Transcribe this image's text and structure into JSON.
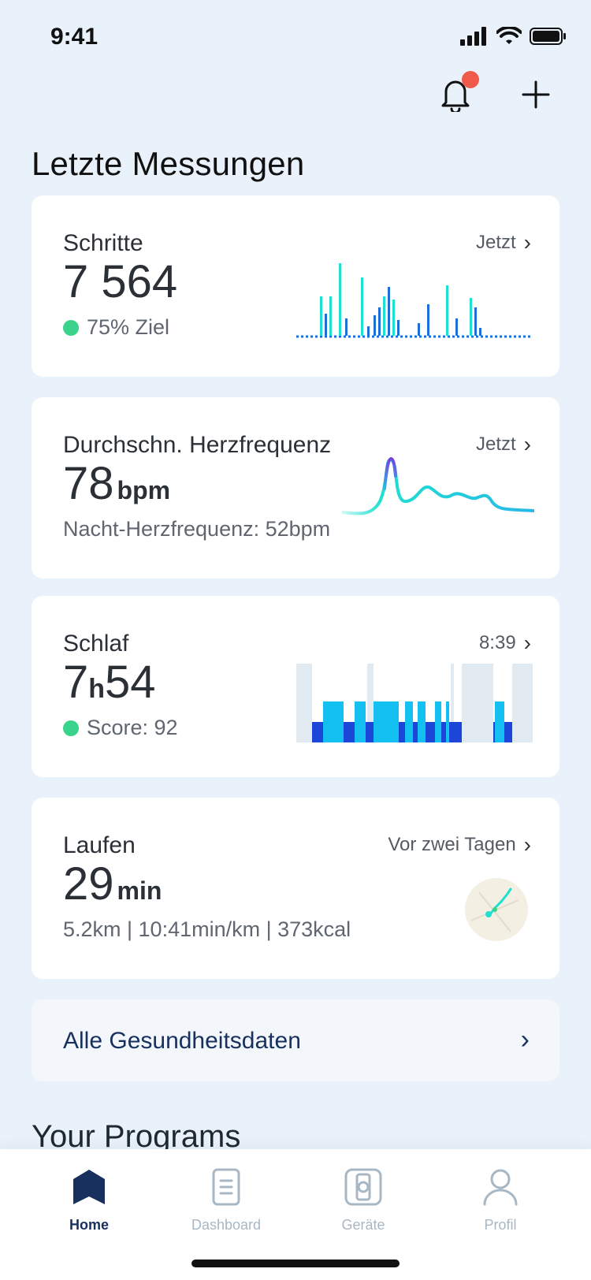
{
  "status_bar": {
    "time": "9:41"
  },
  "header": {
    "title": "Letzte Messungen"
  },
  "cards": {
    "steps": {
      "title": "Schritte",
      "value": "7 564",
      "link": "Jetzt",
      "sub": "75% Ziel"
    },
    "heart": {
      "title": "Durchschn. Herzfrequenz",
      "value": "78",
      "unit": "bpm",
      "link": "Jetzt",
      "sub": "Nacht-Herzfrequenz: 52bpm"
    },
    "sleep": {
      "title": "Schlaf",
      "value_hours": "7",
      "value_h": "h",
      "value_minutes": "54",
      "link": "8:39",
      "sub": "Score: 92"
    },
    "run": {
      "title": "Laufen",
      "value": "29",
      "unit": "min",
      "link": "Vor zwei Tagen",
      "sub": "5.2km | 10:41min/km | 373kcal"
    }
  },
  "all_data": {
    "label": "Alle Gesundheitsdaten"
  },
  "next_section": {
    "title": "Your Programs"
  },
  "nav": [
    {
      "label": "Home",
      "icon": "home-icon",
      "active": true
    },
    {
      "label": "Dashboard",
      "icon": "dashboard-icon",
      "active": false
    },
    {
      "label": "Geräte",
      "icon": "watch-icon",
      "active": false
    },
    {
      "label": "Profil",
      "icon": "profile-icon",
      "active": false
    }
  ],
  "colors": {
    "accent": "#17305e",
    "green": "#3ad38b",
    "cyan": "#1ee0d0",
    "blue": "#1c6fd6",
    "notif": "#f05a4a"
  }
}
